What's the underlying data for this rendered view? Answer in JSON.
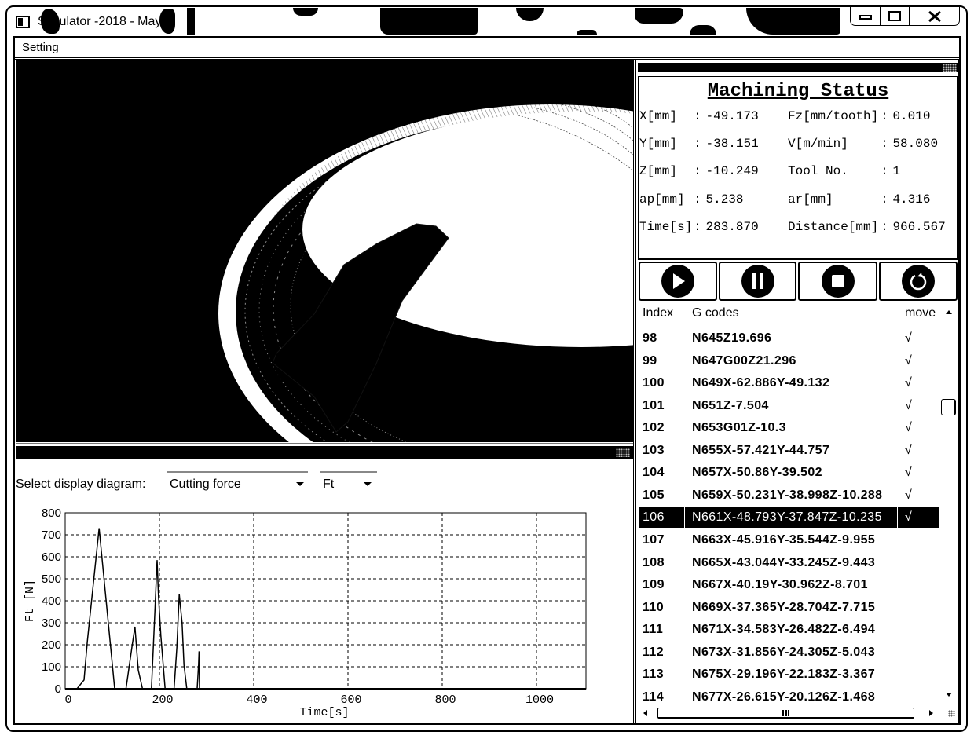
{
  "window": {
    "title": "Simulator -2018 - May",
    "icon": "app-window-icon",
    "controls": {
      "minimize": "minimize-icon",
      "maximize": "maximize-icon",
      "close": "close-icon"
    }
  },
  "menu": {
    "items": [
      {
        "label": "Setting"
      }
    ]
  },
  "viewport": {
    "panel_icon": "pin-icon",
    "scene": [
      "workpiece",
      "machined-pocket",
      "cutting-tool"
    ]
  },
  "status": {
    "title": "Machining Status",
    "separator": ":",
    "left": [
      {
        "label": "X[mm]",
        "value": "-49.173"
      },
      {
        "label": "Y[mm]",
        "value": "-38.151"
      },
      {
        "label": "Z[mm]",
        "value": "-10.249"
      },
      {
        "label": "ap[mm]",
        "value": "5.238"
      },
      {
        "label": "Time[s]",
        "value": "283.870"
      }
    ],
    "right": [
      {
        "label": "Fz[mm/tooth]",
        "value": "0.010"
      },
      {
        "label": "V[m/min]",
        "value": "58.080"
      },
      {
        "label": "Tool No.",
        "value": "1"
      },
      {
        "label": "ar[mm]",
        "value": "4.316"
      },
      {
        "label": "Distance[mm]",
        "value": "966.567"
      }
    ]
  },
  "playback_controls": [
    {
      "action": "play",
      "icon": "play-icon"
    },
    {
      "action": "pause",
      "icon": "pause-icon"
    },
    {
      "action": "stop",
      "icon": "stop-icon"
    },
    {
      "action": "reset",
      "icon": "reset-icon"
    }
  ],
  "gcode_list": {
    "columns": {
      "index": "Index",
      "code": "G codes",
      "move": "move"
    },
    "selected_index": "106",
    "rows": [
      {
        "index": "98",
        "code": "N645Z19.696",
        "move": "√"
      },
      {
        "index": "99",
        "code": "N647G00Z21.296",
        "move": "√"
      },
      {
        "index": "100",
        "code": "N649X-62.886Y-49.132",
        "move": "√"
      },
      {
        "index": "101",
        "code": "N651Z-7.504",
        "move": "√"
      },
      {
        "index": "102",
        "code": "N653G01Z-10.3",
        "move": "√"
      },
      {
        "index": "103",
        "code": "N655X-57.421Y-44.757",
        "move": "√"
      },
      {
        "index": "104",
        "code": "N657X-50.86Y-39.502",
        "move": "√"
      },
      {
        "index": "105",
        "code": "N659X-50.231Y-38.998Z-10.288",
        "move": "√"
      },
      {
        "index": "106",
        "code": "N661X-48.793Y-37.847Z-10.235",
        "move": "√"
      },
      {
        "index": "107",
        "code": "N663X-45.916Y-35.544Z-9.955",
        "move": ""
      },
      {
        "index": "108",
        "code": "N665X-43.044Y-33.245Z-9.443",
        "move": ""
      },
      {
        "index": "109",
        "code": "N667X-40.19Y-30.962Z-8.701",
        "move": ""
      },
      {
        "index": "110",
        "code": "N669X-37.365Y-28.704Z-7.715",
        "move": ""
      },
      {
        "index": "111",
        "code": "N671X-34.583Y-26.482Z-6.494",
        "move": ""
      },
      {
        "index": "112",
        "code": "N673X-31.856Y-24.305Z-5.043",
        "move": ""
      },
      {
        "index": "113",
        "code": "N675X-29.196Y-22.183Z-3.367",
        "move": ""
      },
      {
        "index": "114",
        "code": "N677X-26.615Y-20.126Z-1.468",
        "move": ""
      }
    ]
  },
  "diagram": {
    "select_label": "Select display diagram:",
    "diagram_type": "Cutting force",
    "component": "Ft"
  },
  "chart_data": {
    "type": "line",
    "title": "",
    "xlabel": "Time[s]",
    "ylabel": "Ft [N]",
    "xlim": [
      0,
      1105
    ],
    "ylim": [
      0,
      800
    ],
    "xticks": [
      0,
      200,
      400,
      600,
      800,
      1000
    ],
    "yticks": [
      0,
      100,
      200,
      300,
      400,
      500,
      600,
      700,
      800
    ],
    "grid": true,
    "legend": "none",
    "series": [
      {
        "name": "Ft",
        "x": [
          0,
          25,
          40,
          47,
          72,
          105,
          129,
          143,
          148,
          155,
          164,
          183,
          189,
          195,
          198,
          203,
          212,
          231,
          237,
          242,
          248,
          252,
          258,
          280,
          283,
          284,
          285
        ],
        "y": [
          0,
          0,
          40,
          215,
          730,
          0,
          0,
          210,
          282,
          85,
          0,
          0,
          287,
          585,
          418,
          240,
          0,
          0,
          190,
          430,
          300,
          110,
          0,
          0,
          110,
          170,
          0
        ]
      }
    ]
  }
}
